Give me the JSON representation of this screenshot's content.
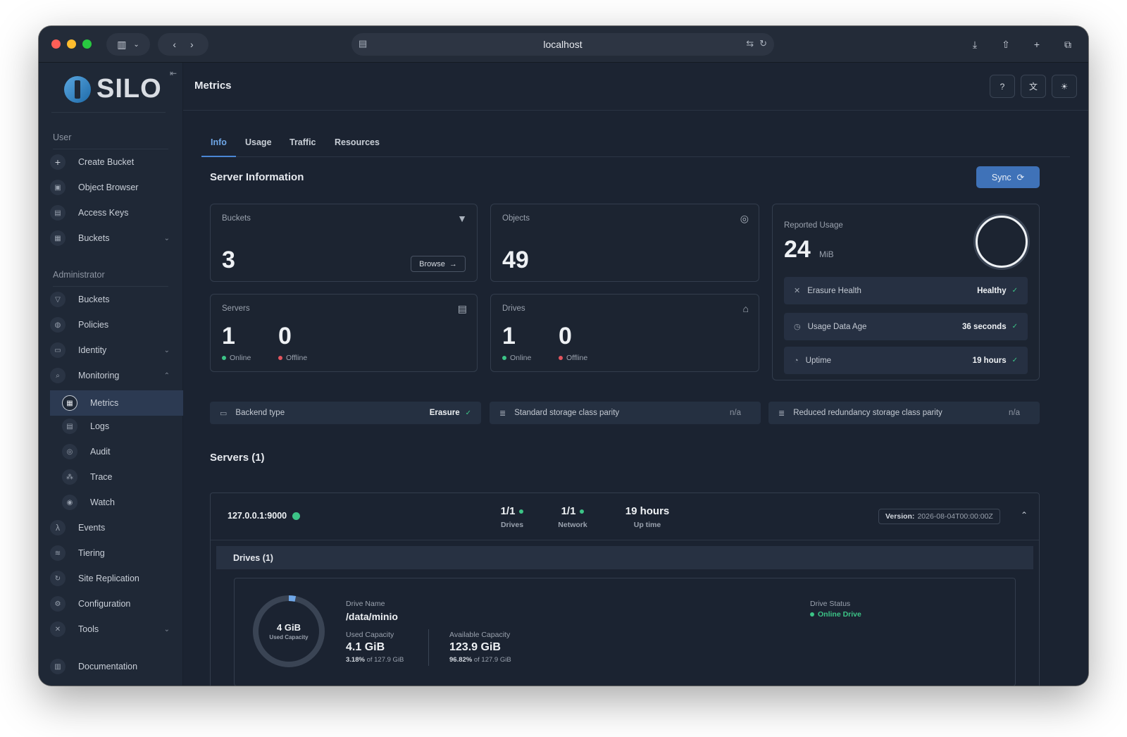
{
  "browser": {
    "url": "localhost"
  },
  "brand": {
    "logo_text": "SILO"
  },
  "sidebar": {
    "user_label": "User",
    "user_items": [
      {
        "label": "Create Bucket",
        "icon": "plus-icon"
      },
      {
        "label": "Object Browser",
        "icon": "object-browser-icon"
      },
      {
        "label": "Access Keys",
        "icon": "access-keys-icon"
      },
      {
        "label": "Buckets",
        "icon": "bucket-icon"
      }
    ],
    "admin_label": "Administrator",
    "admin_items": [
      {
        "label": "Buckets",
        "icon": "bucket-icon"
      },
      {
        "label": "Policies",
        "icon": "policy-icon"
      },
      {
        "label": "Identity",
        "icon": "identity-icon"
      },
      {
        "label": "Monitoring",
        "icon": "monitoring-icon"
      }
    ],
    "monitoring_items": [
      {
        "label": "Metrics",
        "icon": "metrics-icon"
      },
      {
        "label": "Logs",
        "icon": "logs-icon"
      },
      {
        "label": "Audit",
        "icon": "audit-icon"
      },
      {
        "label": "Trace",
        "icon": "trace-icon"
      },
      {
        "label": "Watch",
        "icon": "watch-icon"
      }
    ],
    "more_items": [
      {
        "label": "Events",
        "icon": "lambda-icon"
      },
      {
        "label": "Tiering",
        "icon": "tiering-icon"
      },
      {
        "label": "Site Replication",
        "icon": "replication-icon"
      },
      {
        "label": "Configuration",
        "icon": "gear-icon"
      },
      {
        "label": "Tools",
        "icon": "tools-icon"
      },
      {
        "label": "Documentation",
        "icon": "documentation-icon"
      }
    ]
  },
  "header": {
    "title": "Metrics"
  },
  "tabs": [
    "Info",
    "Usage",
    "Traffic",
    "Resources"
  ],
  "server_info": {
    "title": "Server Information",
    "sync_label": "Sync",
    "buckets": {
      "label": "Buckets",
      "value": "3",
      "browse_label": "Browse"
    },
    "objects": {
      "label": "Objects",
      "value": "49"
    },
    "servers": {
      "label": "Servers",
      "online": "1",
      "offline": "0",
      "online_label": "Online",
      "offline_label": "Offline"
    },
    "drives": {
      "label": "Drives",
      "online": "1",
      "offline": "0",
      "online_label": "Online",
      "offline_label": "Offline"
    },
    "reported_usage": {
      "label": "Reported Usage",
      "value": "24",
      "unit": "MiB"
    },
    "erasure_health": {
      "label": "Erasure Health",
      "value": "Healthy"
    },
    "usage_data_age": {
      "label": "Usage Data Age",
      "value": "36 seconds"
    },
    "uptime": {
      "label": "Uptime",
      "value": "19 hours"
    },
    "backend_type": {
      "label": "Backend type",
      "value": "Erasure"
    },
    "standard_parity": {
      "label": "Standard storage class parity",
      "value": "n/a"
    },
    "reduced_parity": {
      "label": "Reduced redundancy storage class parity",
      "value": "n/a"
    }
  },
  "servers_section": {
    "title": "Servers (1)",
    "server": {
      "address": "127.0.0.1:9000",
      "drives_value": "1/1",
      "drives_label": "Drives",
      "network_value": "1/1",
      "network_label": "Network",
      "uptime_value": "19 hours",
      "uptime_label": "Up time",
      "version_label": "Version:",
      "version_value": "2026-08-04T00:00:00Z"
    },
    "drives_header": "Drives (1)",
    "drive": {
      "used_ring_value": "4 GiB",
      "used_ring_label": "Used Capacity",
      "used_fraction": 0.0318,
      "name_label": "Drive Name",
      "name": "/data/minio",
      "used_label": "Used Capacity",
      "used_value": "4.1 GiB",
      "used_pct": "3.18%",
      "used_of": "of 127.9 GiB",
      "avail_label": "Available Capacity",
      "avail_value": "123.9 GiB",
      "avail_pct": "96.82%",
      "avail_of": "of 127.9 GiB",
      "status_label": "Drive Status",
      "status_value": "Online Drive"
    }
  },
  "colors": {
    "accent": "#3f72b8",
    "online": "#3cc487",
    "offline": "#e2555e"
  }
}
